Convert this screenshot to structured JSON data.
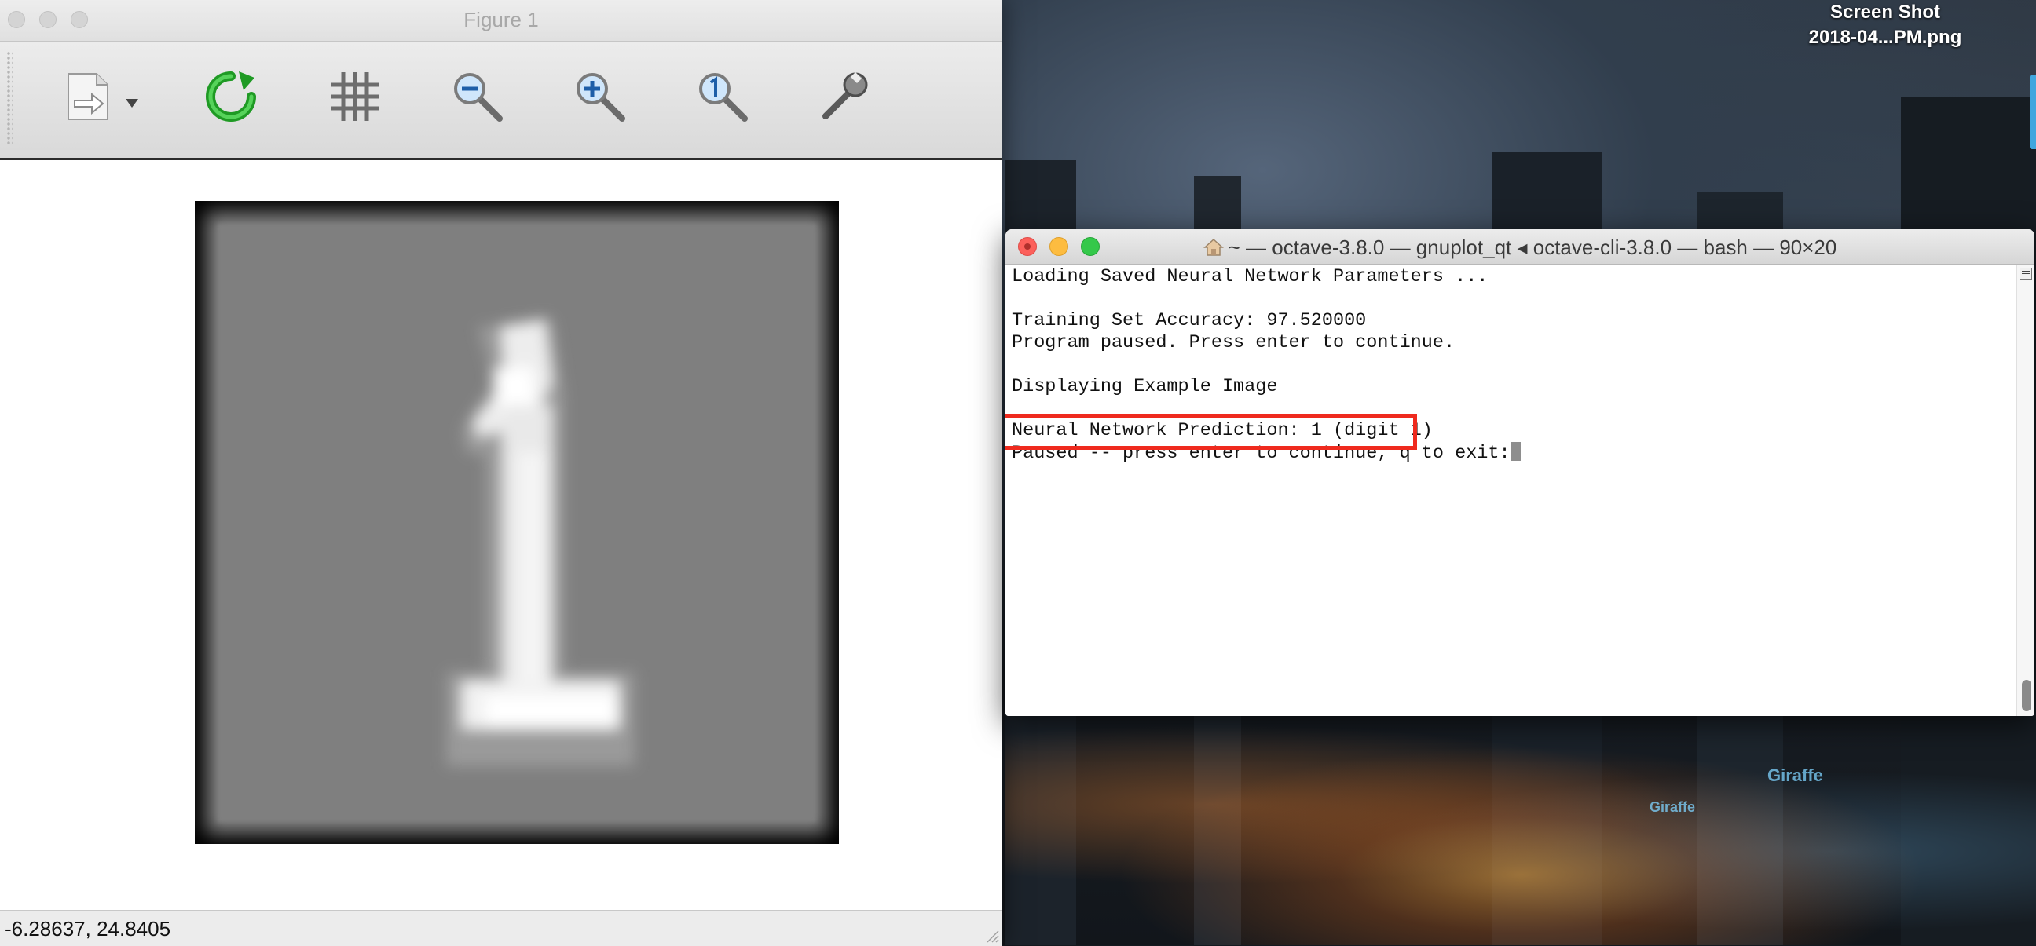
{
  "desktop": {
    "file_icon_label_line1": "Screen Shot",
    "file_icon_label_line2": "2018-04...PM.png"
  },
  "figure_window": {
    "title": "Figure 1",
    "toolbar": {
      "tools": [
        {
          "name": "export-icon"
        },
        {
          "name": "dropdown-arrow-icon"
        },
        {
          "name": "refresh-icon"
        },
        {
          "name": "grid-icon"
        },
        {
          "name": "zoom-out-icon"
        },
        {
          "name": "zoom-in-icon"
        },
        {
          "name": "zoom-reset-icon"
        },
        {
          "name": "settings-wrench-icon"
        }
      ]
    },
    "status": {
      "coordinates": "-6.28637,  24.8405"
    }
  },
  "terminal_window": {
    "title": "~ — octave-3.8.0 — gnuplot_qt ◂ octave-cli-3.8.0 — bash — 90×20",
    "lines": [
      "Loading Saved Neural Network Parameters ...",
      "",
      "Training Set Accuracy: 97.520000",
      "Program paused. Press enter to continue.",
      "",
      "Displaying Example Image",
      "",
      "Neural Network Prediction: 1 (digit 1)",
      "Paused -- press enter to continue, q to exit:"
    ],
    "highlight_color": "#ef2a1e"
  }
}
